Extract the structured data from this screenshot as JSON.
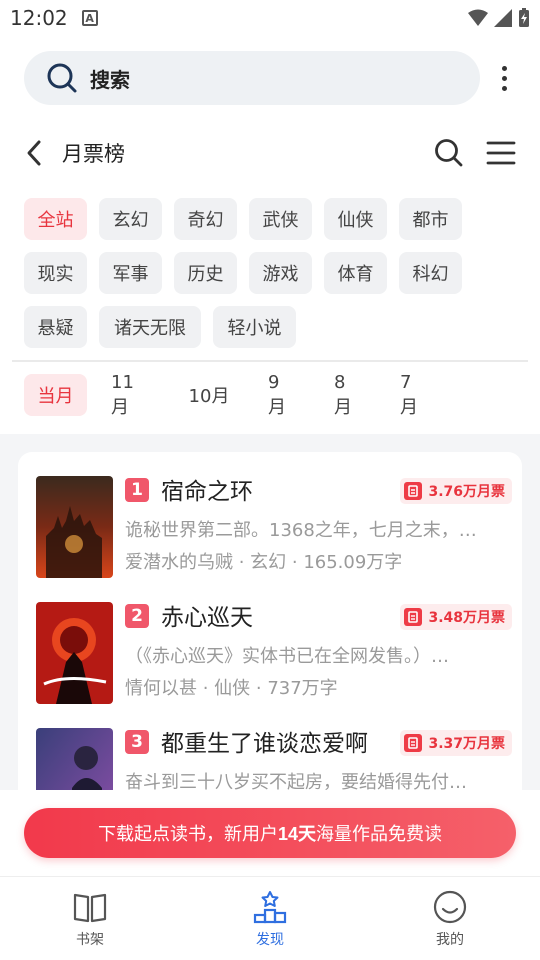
{
  "status_bar": {
    "time": "12:02",
    "notification_letter": "A"
  },
  "search": {
    "placeholder": "搜索"
  },
  "header": {
    "title": "月票榜"
  },
  "categories": [
    "全站",
    "玄幻",
    "奇幻",
    "武侠",
    "仙侠",
    "都市",
    "现实",
    "军事",
    "历史",
    "游戏",
    "体育",
    "科幻",
    "悬疑",
    "诸天无限",
    "轻小说"
  ],
  "selected_category": "全站",
  "months": [
    "当月",
    "11月",
    "10月",
    "9月",
    "8月",
    "7月"
  ],
  "selected_month": "当月",
  "books": [
    {
      "rank": "1",
      "title": "宿命之环",
      "tickets": "3.76万月票",
      "desc": "诡秘世界第二部。1368之年，七月之末，…",
      "meta": "爱潜水的乌贼 · 玄幻 · 165.09万字",
      "cover_text": "宿命之环"
    },
    {
      "rank": "2",
      "title": "赤心巡天",
      "tickets": "3.48万月票",
      "desc": "（《赤心巡天》实体书已在全网发售。）…",
      "meta": "情何以甚 · 仙侠 · 737万字",
      "cover_text": "赤心巡天"
    },
    {
      "rank": "3",
      "title": "都重生了谁谈恋爱啊",
      "tickets": "3.37万月票",
      "desc": "奋斗到三十八岁买不起房，要结婚得先付…",
      "meta": "",
      "cover_text": "都重生了"
    }
  ],
  "promo": {
    "pre": "下载起点读书，新用户",
    "highlight": "14天",
    "post": "海量作品免费读"
  },
  "tabbar": [
    {
      "label": "书架",
      "icon": "book-icon"
    },
    {
      "label": "发现",
      "icon": "podium-icon"
    },
    {
      "label": "我的",
      "icon": "smile-icon"
    }
  ],
  "colors": {
    "accent": "#e8343e",
    "tab_active": "#2f6fe0",
    "chip_bg": "#f0f1f3"
  }
}
